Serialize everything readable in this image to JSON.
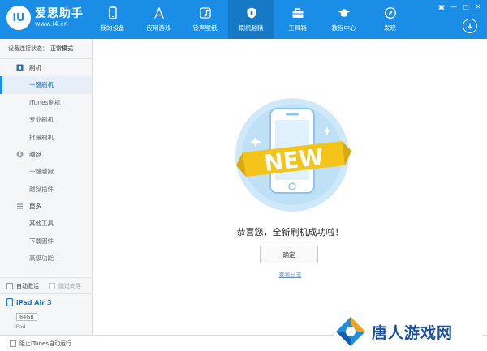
{
  "app": {
    "logo_mark": "iU",
    "name": "爱思助手",
    "url": "www.i4.cn"
  },
  "nav": [
    {
      "label": "我的设备",
      "icon": "phone-icon"
    },
    {
      "label": "应用游戏",
      "icon": "app-store-icon"
    },
    {
      "label": "铃声壁纸",
      "icon": "music-icon"
    },
    {
      "label": "刷机越狱",
      "icon": "shield-icon",
      "active": true
    },
    {
      "label": "工具箱",
      "icon": "toolbox-icon"
    },
    {
      "label": "教程中心",
      "icon": "graduation-cap-icon"
    },
    {
      "label": "发现",
      "icon": "compass-icon"
    }
  ],
  "window_controls": [
    "▣",
    "—",
    "▢",
    "✕"
  ],
  "sidebar": {
    "status_label": "设备连接状态：",
    "status_value": "正常模式",
    "group_flash": "刷机",
    "item_onekey": "一键刷机",
    "item_itunes": "iTunes刷机",
    "item_pro": "专业刷机",
    "item_batch": "批量刷机",
    "group_jailbreak": "越狱",
    "item_onekey_jb": "一键越狱",
    "item_jb_plugin": "越狱插件",
    "group_more": "更多",
    "item_other_tools": "其他工具",
    "item_download_fw": "下载固件",
    "item_advanced": "高级功能",
    "check_auto_activate": "自动激活",
    "check_skip_guide": "跳过向导"
  },
  "device": {
    "name": "iPad Air 3",
    "capacity": "64GB",
    "type": "iPad"
  },
  "main": {
    "badge_text": "NEW",
    "success_message": "恭喜您，全新刷机成功啦！",
    "ok_button": "确定",
    "view_log_link": "查看日志"
  },
  "footer": {
    "block_itunes_label": "阻止iTunes自动运行"
  },
  "watermark": {
    "text": "唐人游戏网"
  },
  "colors": {
    "topbar": "#1a8de6",
    "topbar_active": "#1579c6",
    "illustration_circle": "#cfe9fa",
    "ribbon": "#f5c418",
    "badge_text": "#ffffff"
  }
}
